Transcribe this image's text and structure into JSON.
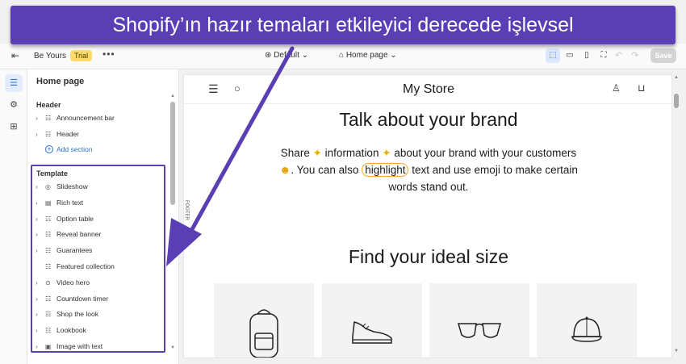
{
  "banner": {
    "text": "Shopify’ın hazır temaları etkileyici derecede işlevsel"
  },
  "topbar": {
    "theme_name": "Be Yours",
    "trial_badge": "Trial",
    "more": "•••",
    "default_label": "Default",
    "page_label": "Home page",
    "save_label": "Save"
  },
  "sidebar": {
    "title": "Home page",
    "header_group": "Header",
    "header_items": [
      {
        "label": "Announcement bar",
        "icon": "section-icon"
      },
      {
        "label": "Header",
        "icon": "section-icon"
      }
    ],
    "add_section": "Add section",
    "template_group": "Template",
    "template_items": [
      {
        "label": "Slideshow",
        "icon": "slideshow-icon"
      },
      {
        "label": "Rich text",
        "icon": "text-icon"
      },
      {
        "label": "Option table",
        "icon": "section-icon"
      },
      {
        "label": "Reveal banner",
        "icon": "section-icon"
      },
      {
        "label": "Guarantees",
        "icon": "section-icon"
      },
      {
        "label": "Featured collection",
        "icon": "section-icon"
      },
      {
        "label": "Video hero",
        "icon": "play-icon"
      },
      {
        "label": "Countdown timer",
        "icon": "section-icon"
      },
      {
        "label": "Shop the look",
        "icon": "section-icon"
      },
      {
        "label": "Lookbook",
        "icon": "section-icon"
      },
      {
        "label": "Image with text",
        "icon": "image-text-icon"
      }
    ]
  },
  "preview": {
    "store_name": "My Store",
    "heading": "Talk about your brand",
    "body_1": "Share",
    "body_2": "information",
    "body_3": "about your brand with your customers",
    "body_4": ". You can also",
    "body_highlight": "highlight",
    "body_5": "text and  use emoji  to make certain words stand out.",
    "heading_2": "Find your ideal size",
    "side_label": "FOOTER",
    "products": [
      {
        "icon": "backpack-icon"
      },
      {
        "icon": "sneaker-icon"
      },
      {
        "icon": "sunglasses-icon"
      },
      {
        "icon": "cap-icon"
      }
    ]
  },
  "colors": {
    "banner": "#5a3fb4",
    "highlight_outline": "#f0a830",
    "accent_blue": "#2c6ecb"
  }
}
